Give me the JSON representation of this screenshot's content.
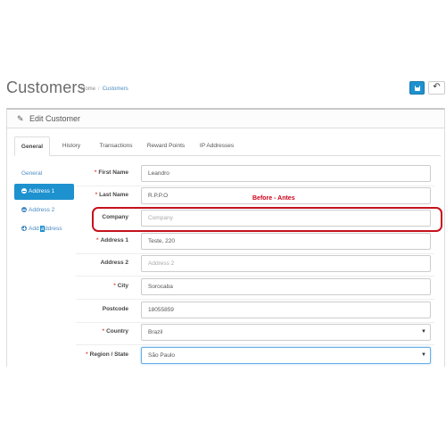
{
  "header": {
    "title": "Customers",
    "breadcrumb": {
      "home": "Home",
      "separator": "/",
      "current": "Customers"
    },
    "save_icon": "save-icon",
    "back_icon": "reply-icon",
    "back_glyph": "↶"
  },
  "panel": {
    "title": "Edit Customer",
    "icon": "pencil-icon",
    "icon_glyph": "✎"
  },
  "tabs": [
    {
      "label": "General",
      "active": true
    },
    {
      "label": "History"
    },
    {
      "label": "Transactions"
    },
    {
      "label": "Reward Points"
    },
    {
      "label": "IP Addresses"
    }
  ],
  "side_nav": {
    "general": "General",
    "address1": "Address 1",
    "address2": "Address 2",
    "add_prefix": "Add ",
    "add_cursor": "a",
    "add_suffix": "ddress"
  },
  "form": {
    "first_name": {
      "label": "First Name",
      "required": true,
      "value": "Leandro"
    },
    "last_name": {
      "label": "Last Name",
      "required": true,
      "value": "R.P.P.O"
    },
    "company": {
      "label": "Company",
      "required": false,
      "placeholder": "Company"
    },
    "address1": {
      "label": "Address 1",
      "required": true,
      "value": "Teste, 220"
    },
    "address2": {
      "label": "Address 2",
      "required": false,
      "placeholder": "Address 2"
    },
    "city": {
      "label": "City",
      "required": true,
      "value": "Sorocaba"
    },
    "postcode": {
      "label": "Postcode",
      "required": false,
      "value": "18055859"
    },
    "country": {
      "label": "Country",
      "required": true,
      "value": "Brazil"
    },
    "region": {
      "label": "Region / State",
      "required": true,
      "value": "São Paulo"
    },
    "required_mark": "*",
    "caret_glyph": "▼"
  },
  "annotation": {
    "text": "Before - Antes",
    "color": "#d0021b"
  },
  "colors": {
    "accent": "#1e91cf",
    "required": "#e3503e",
    "highlight": "#c4121d"
  }
}
